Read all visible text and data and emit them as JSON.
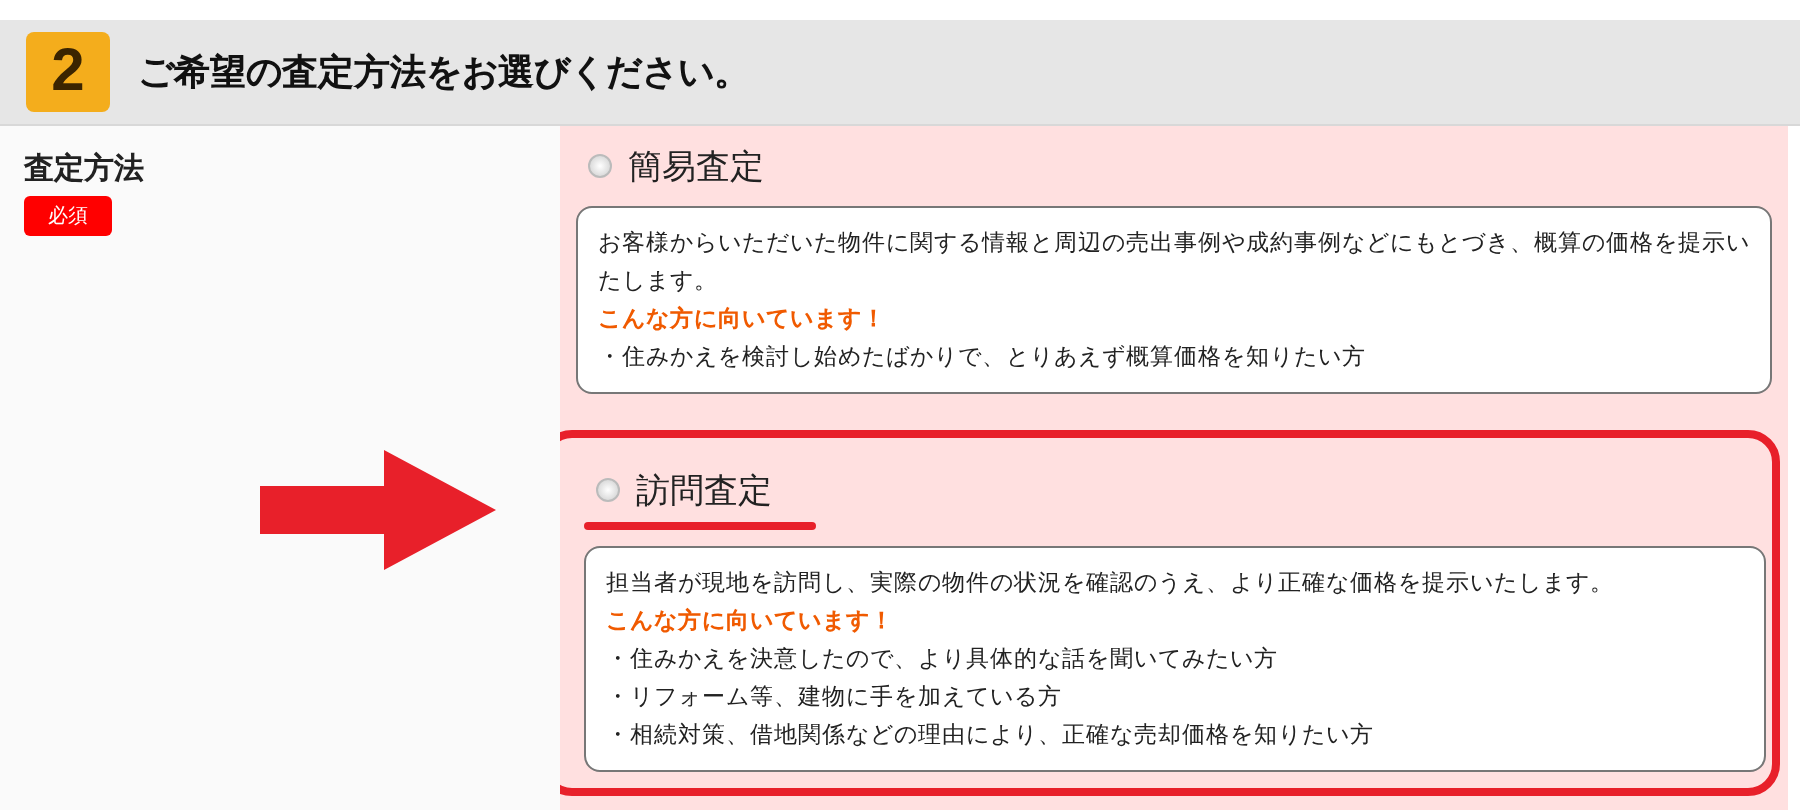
{
  "section": {
    "number": "2",
    "title": "ご希望の査定方法をお選びください。"
  },
  "field": {
    "label": "査定方法",
    "badge": "必須"
  },
  "options": [
    {
      "label": "簡易査定",
      "selected": false,
      "highlighted": false,
      "description": "お客様からいただいた物件に関する情報と周辺の売出事例や成約事例などにもとづき、概算の価格を提示いたします。",
      "suited_heading": "こんな方に向いています！",
      "suited_items": [
        "・住みかえを検討し始めたばかりで、とりあえず概算価格を知りたい方"
      ]
    },
    {
      "label": "訪問査定",
      "selected": false,
      "highlighted": true,
      "description": "担当者が現地を訪問し、実際の物件の状況を確認のうえ、より正確な価格を提示いたします。",
      "suited_heading": "こんな方に向いています！",
      "suited_items": [
        "・住みかえを決意したので、より具体的な話を聞いてみたい方",
        "・リフォーム等、建物に手を加えている方",
        "・相続対策、借地関係などの理由により、正確な売却価格を知りたい方"
      ]
    }
  ]
}
